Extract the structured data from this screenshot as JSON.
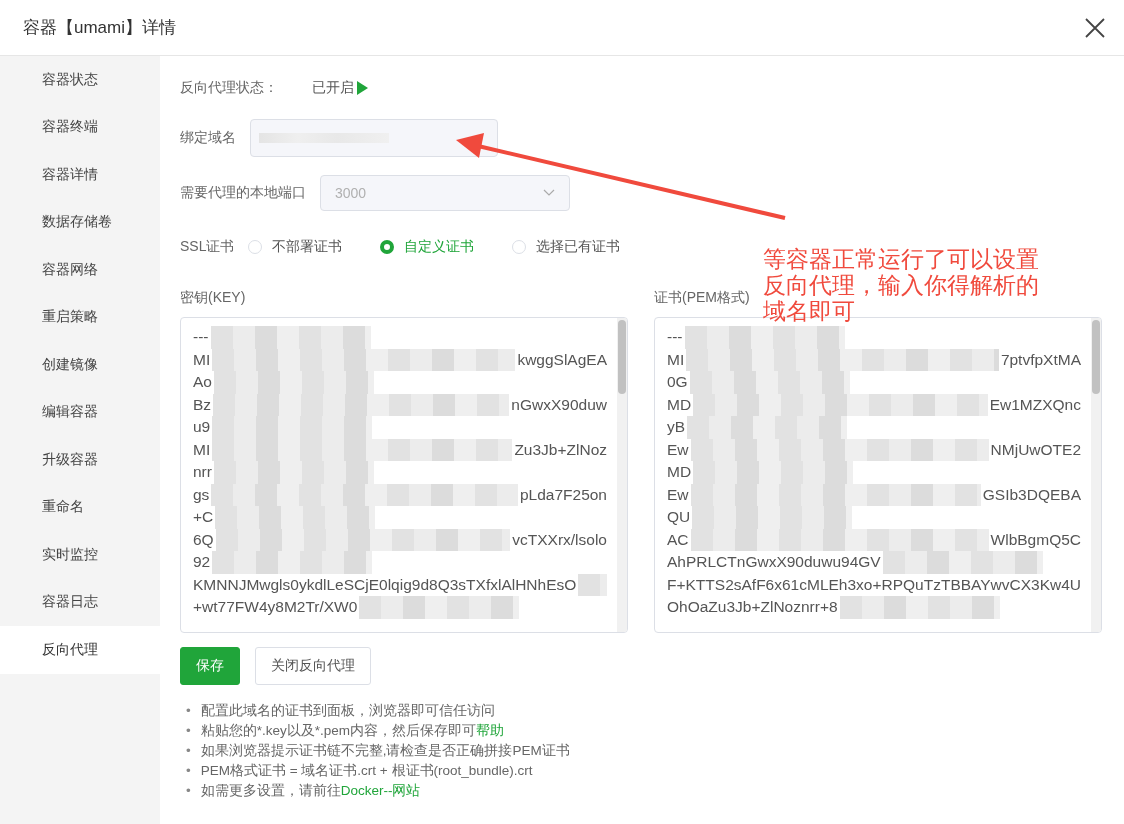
{
  "window": {
    "title": "容器【umami】详情"
  },
  "sidebar": {
    "items": [
      {
        "label": "容器状态",
        "selected": false
      },
      {
        "label": "容器终端",
        "selected": false
      },
      {
        "label": "容器详情",
        "selected": false
      },
      {
        "label": "数据存储卷",
        "selected": false
      },
      {
        "label": "容器网络",
        "selected": false
      },
      {
        "label": "重启策略",
        "selected": false
      },
      {
        "label": "创建镜像",
        "selected": false
      },
      {
        "label": "编辑容器",
        "selected": false
      },
      {
        "label": "升级容器",
        "selected": false
      },
      {
        "label": "重命名",
        "selected": false
      },
      {
        "label": "实时监控",
        "selected": false
      },
      {
        "label": "容器日志",
        "selected": false
      },
      {
        "label": "反向代理",
        "selected": true
      }
    ]
  },
  "proxy_status": {
    "label": "反向代理状态：",
    "value": "已开启",
    "on": true
  },
  "domain": {
    "label": "绑定域名"
  },
  "port": {
    "label": "需要代理的本地端口",
    "value": "3000",
    "disabled": true
  },
  "ssl": {
    "label": "SSL证书",
    "options": [
      {
        "label": "不部署证书",
        "selected": false
      },
      {
        "label": "自定义证书",
        "selected": true
      },
      {
        "label": "选择已有证书",
        "selected": false
      }
    ]
  },
  "key": {
    "label": "密钥(KEY)",
    "lines": [
      {
        "start": "---"
      },
      {
        "start": "MI",
        "end": "kwggSlAgEA"
      },
      {
        "start": "Ao"
      },
      {
        "start": "Bz",
        "end": "nGwxX90duw"
      },
      {
        "start": "u9"
      },
      {
        "start": "MI",
        "end": "Zu3Jb+ZlNoz"
      },
      {
        "start": "nrr"
      },
      {
        "start": "gs",
        "end": "pLda7F25on"
      },
      {
        "start": "+C"
      },
      {
        "start": "6Q",
        "end": "vcTXXrx/lsolo"
      },
      {
        "start": "92"
      },
      {
        "start": "KMNNJMwgls0ykdlLeSCjE0lqig9d8Q3sTXfxlAlHNhEsO"
      },
      {
        "start": "+wt77FW4y8M2Tr/XW0"
      }
    ]
  },
  "cert": {
    "label": "证书(PEM格式)",
    "lines": [
      {
        "start": "---"
      },
      {
        "start": "MI",
        "end": "7ptvfpXtMA"
      },
      {
        "start": "0G"
      },
      {
        "start": "MD",
        "end": "Ew1MZXQnc"
      },
      {
        "start": "yB"
      },
      {
        "start": "Ew",
        "end": "NMjUwOTE2"
      },
      {
        "start": "MD"
      },
      {
        "start": "Ew",
        "end": "GSIb3DQEBA"
      },
      {
        "start": "QU"
      },
      {
        "start": "AC",
        "end": "WlbBgmQ5C"
      },
      {
        "start": "AhPRLCTnGwxX90duwu94GV"
      },
      {
        "start": "F+KTTS2sAfF6x61cMLEh3xo+RPQuTzTBBAYwvCX3Kw4U"
      },
      {
        "start": "OhOaZu3Jb+ZlNoznrr+8"
      }
    ]
  },
  "buttons": [
    {
      "label": "保存",
      "kind": "primary"
    },
    {
      "label": "关闭反向代理",
      "kind": "default"
    }
  ],
  "notes": [
    {
      "marker": "•",
      "text": "配置此域名的证书到面板，浏览器即可信任访问"
    },
    {
      "marker": "•",
      "text": "粘贴您的*.key以及*.pem内容，然后保存即可",
      "link": "帮助"
    },
    {
      "marker": "•",
      "text": "如果浏览器提示证书链不完整,请检查是否正确拼接PEM证书"
    },
    {
      "marker": "•",
      "text": "PEM格式证书 = 域名证书.crt + 根证书(root_bundle).crt"
    },
    {
      "marker": "•",
      "text": "如需更多设置，请前往",
      "link": "Docker--网站"
    }
  ],
  "annotation": {
    "text": "等容器正常运行了可以设置反向代理，输入你得解析的域名即可"
  }
}
